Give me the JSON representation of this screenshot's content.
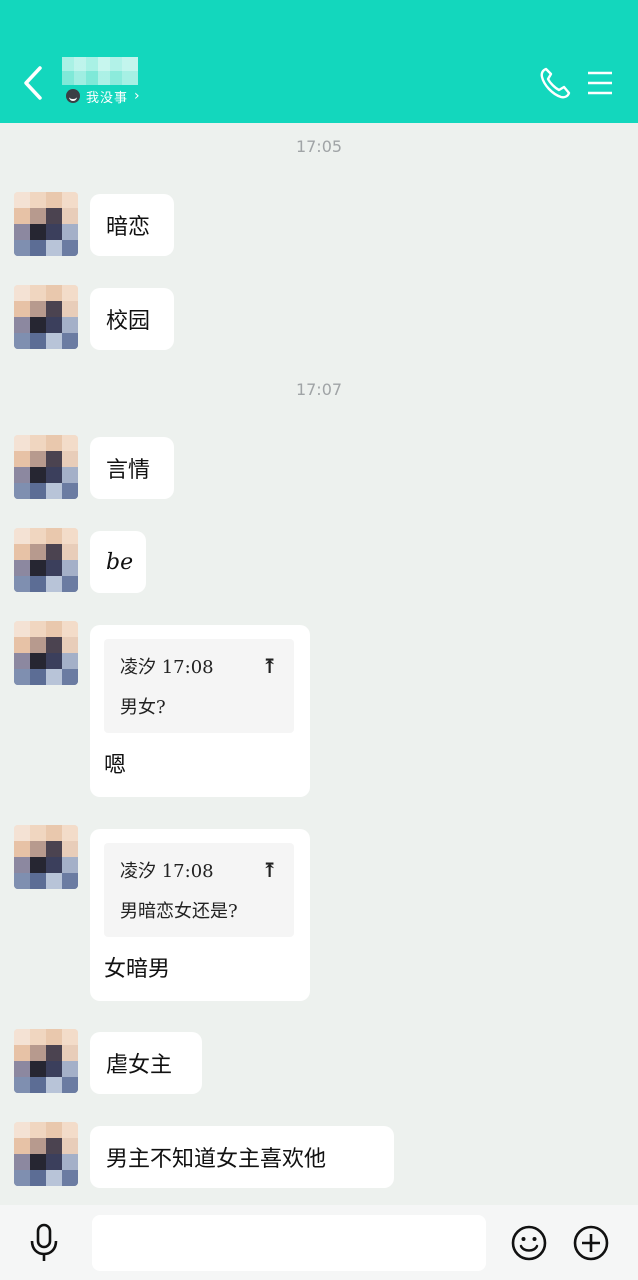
{
  "header": {
    "status_text": "我没事",
    "status_chevron": "›",
    "accent_color": "#13d7bd",
    "icons": [
      "back-arrow-icon",
      "phone-icon",
      "menu-icon"
    ]
  },
  "timestamps": [
    "17:05",
    "17:07"
  ],
  "messages": [
    {
      "text": "暗恋"
    },
    {
      "text": "校园"
    },
    {
      "text": "言情"
    },
    {
      "text": "be"
    },
    {
      "quote_author": "凌汐",
      "quote_time": "17:08",
      "quote_text": "男女?",
      "text": "嗯"
    },
    {
      "quote_author": "凌汐",
      "quote_time": "17:08",
      "quote_text": "男暗恋女还是?",
      "text": "女暗男"
    },
    {
      "text": "虐女主"
    },
    {
      "text": "男主不知道女主喜欢他"
    }
  ],
  "input": {
    "value": "",
    "placeholder": ""
  },
  "bottom_icons": [
    "microphone-icon",
    "emoji-icon",
    "plus-icon"
  ]
}
